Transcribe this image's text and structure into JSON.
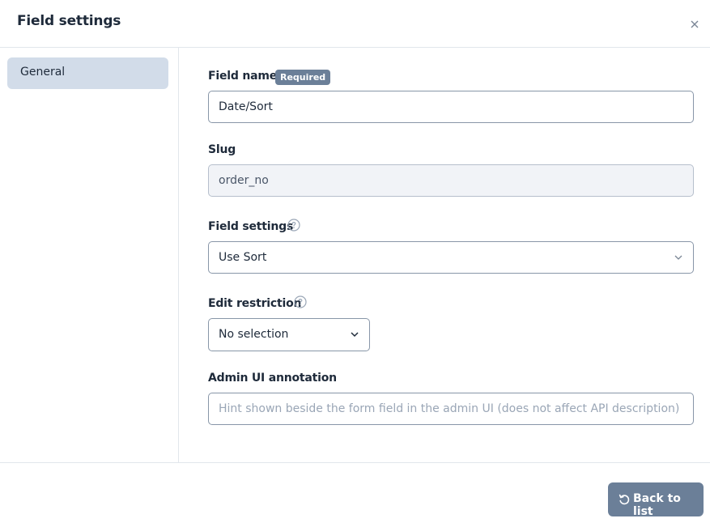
{
  "header": {
    "title": "Field settings",
    "close_icon": "close-icon"
  },
  "sidebar": {
    "items": [
      {
        "label": "General",
        "active": true
      }
    ]
  },
  "form": {
    "field_name": {
      "label": "Field name",
      "badge": "Required",
      "value": "Date/Sort"
    },
    "slug": {
      "label": "Slug",
      "value": "order_no"
    },
    "field_settings": {
      "label": "Field settings",
      "help_icon": "help-circle-icon",
      "value": "Use Sort"
    },
    "edit_restriction": {
      "label": "Edit restriction",
      "help_icon": "help-circle-icon",
      "value": "No selection"
    },
    "admin_annotation": {
      "label": "Admin UI annotation",
      "placeholder": "Hint shown beside the form field in the admin UI (does not affect API description)",
      "value": ""
    }
  },
  "footer": {
    "back_label": "Back to list",
    "back_icon": "undo-icon"
  },
  "colors": {
    "accent": "#6b7f98",
    "sidebar_active": "#d2dce9"
  }
}
